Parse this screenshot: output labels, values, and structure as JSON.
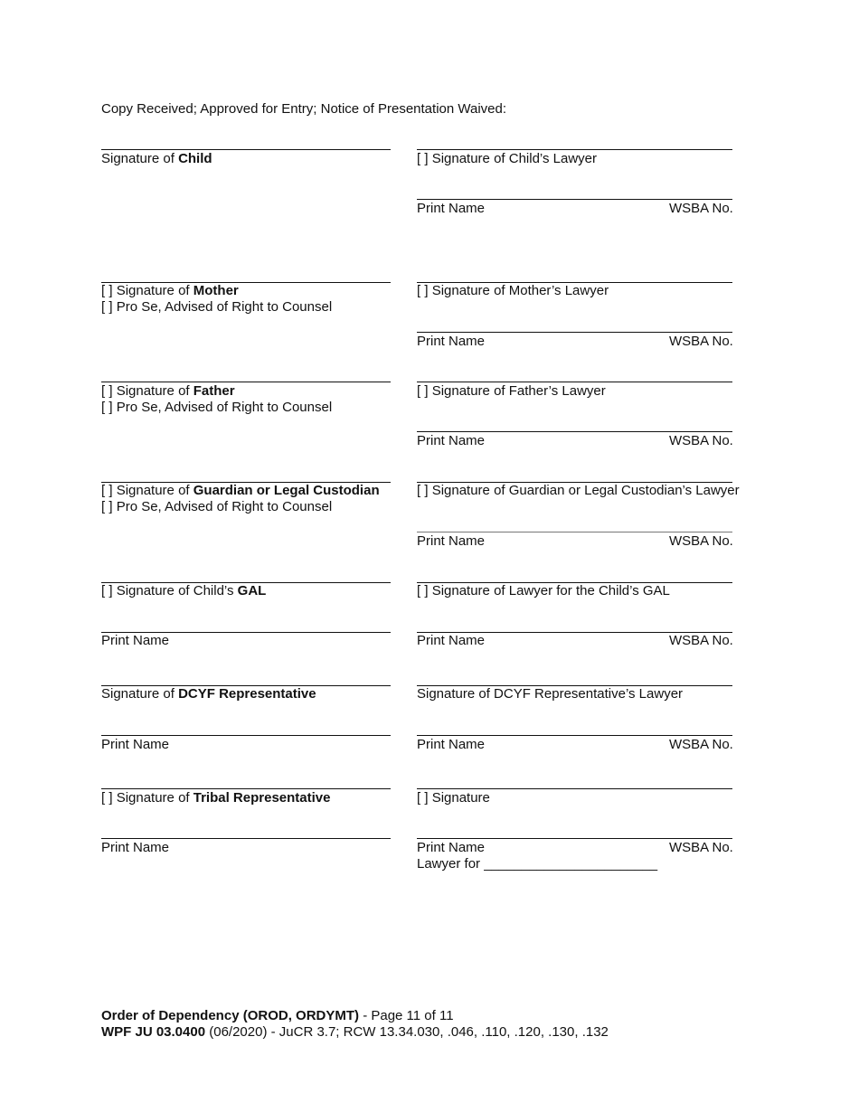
{
  "header": {
    "intro": "Copy Received; Approved for Entry; Notice of Presentation Waived:"
  },
  "common": {
    "checkbox": "[ ]",
    "print_name": "Print Name",
    "wsba_no": "WSBA No.",
    "signature_of": "Signature of ",
    "pro_se": "Pro Se, Advised of Right to Counsel"
  },
  "rows": [
    {
      "left": {
        "checkbox": false,
        "prefix": "Signature of ",
        "bold": "Child",
        "pro_se": false
      },
      "right": {
        "checkbox": true,
        "label": "Signature of Child’s Lawyer"
      }
    },
    {
      "left": {
        "checkbox": true,
        "prefix": "Signature of ",
        "bold": "Mother",
        "pro_se": true
      },
      "right": {
        "checkbox": true,
        "label": "Signature of Mother’s Lawyer"
      }
    },
    {
      "left": {
        "checkbox": true,
        "prefix": "Signature of ",
        "bold": "Father",
        "pro_se": true
      },
      "right": {
        "checkbox": true,
        "label": "Signature of Father’s Lawyer"
      }
    },
    {
      "left": {
        "checkbox": true,
        "prefix": "Signature of ",
        "bold": "Guardian or Legal Custodian",
        "pro_se": true
      },
      "right": {
        "checkbox": true,
        "label": "Signature of Guardian or Legal Custodian’s Lawyer"
      }
    },
    {
      "left": {
        "checkbox": true,
        "prefix": "Signature of Child’s ",
        "bold": "GAL",
        "print_name": "Print Name"
      },
      "right": {
        "checkbox": true,
        "label": "Signature of Lawyer for the Child’s GAL"
      }
    },
    {
      "left": {
        "checkbox": false,
        "prefix": "Signature of ",
        "bold": "DCYF Representative",
        "print_name": "Print Name"
      },
      "right": {
        "checkbox": false,
        "label": "Signature of DCYF Representative’s Lawyer"
      }
    },
    {
      "left": {
        "checkbox": true,
        "prefix": "Signature of ",
        "bold": "Tribal Representative",
        "print_name": "Print Name"
      },
      "right": {
        "checkbox": true,
        "label": "Signature",
        "lawyer_for": "Lawyer for _______________________"
      }
    }
  ],
  "footer": {
    "line1_bold": "Order of Dependency (OROD, ORDYMT)",
    "line1_rest": " - Page 11 of 11",
    "line2_bold": "WPF JU 03.0400",
    "line2_rest": " (06/2020) - JuCR 3.7; RCW 13.34.030, .046, .110, .120, .130, .132"
  }
}
